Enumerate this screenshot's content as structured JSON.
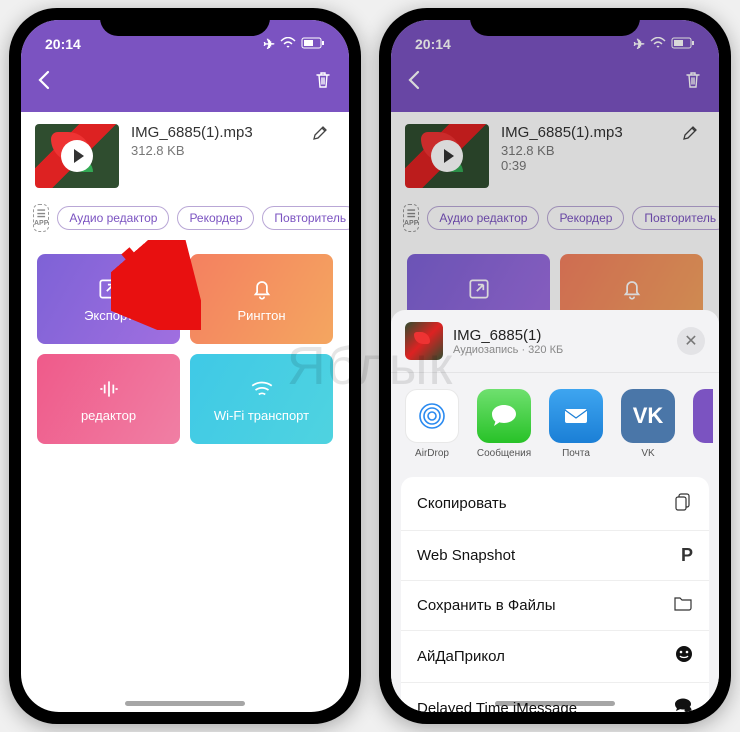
{
  "status": {
    "time": "20:14"
  },
  "nav": {
    "back": "‹",
    "trash": "🗑"
  },
  "file": {
    "name": "IMG_6885(1).mp3",
    "size": "312.8 KB",
    "duration": "0:39"
  },
  "chips": {
    "audio_editor": "Аудио редактор",
    "recorder": "Рекордер",
    "repeater": "Повторитель"
  },
  "tiles": {
    "export": "Экспорт",
    "ringtone": "Рингтон",
    "editor": "редактор",
    "wifi": "Wi-Fi транспорт"
  },
  "share": {
    "title": "IMG_6885(1)",
    "subtitle": "Аудиозапись · 320 КБ",
    "apps": {
      "airdrop": "AirDrop",
      "messages": "Сообщения",
      "mail": "Почта",
      "vk": "VK",
      "vk_glyph": "VK"
    },
    "actions": {
      "copy": "Скопировать",
      "web_snapshot": "Web Snapshot",
      "save_files": "Сохранить в Файлы",
      "aidaprikol": "АйДаПрикол",
      "delayed_imsg": "Delayed Time iMessage"
    }
  },
  "watermark": "Яблык"
}
